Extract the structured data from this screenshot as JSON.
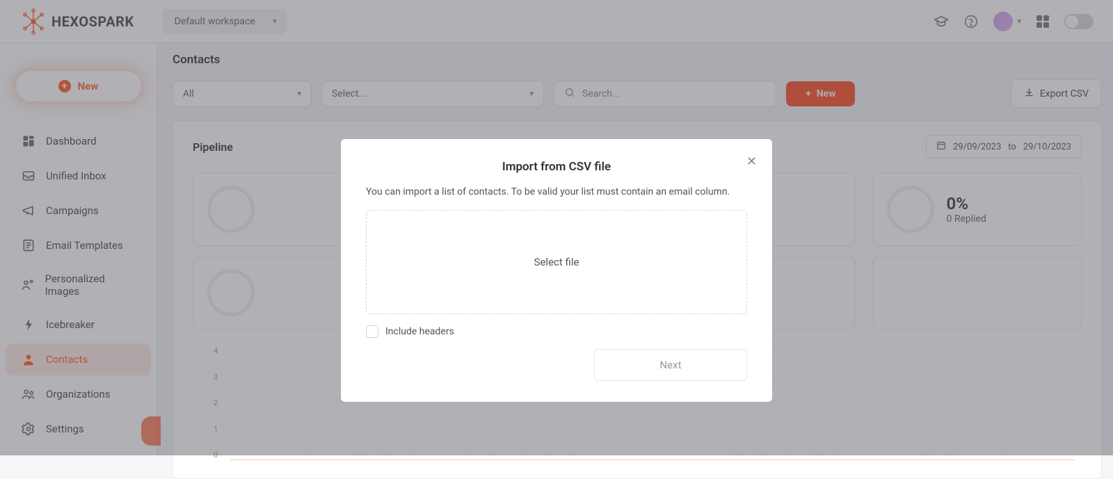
{
  "brand": "HEXOSPARK",
  "workspace": {
    "label": "Default workspace"
  },
  "sidebar": {
    "new_label": "New",
    "items": [
      {
        "label": "Dashboard",
        "icon": "dashboard-icon"
      },
      {
        "label": "Unified Inbox",
        "icon": "inbox-icon"
      },
      {
        "label": "Campaigns",
        "icon": "campaigns-icon"
      },
      {
        "label": "Email Templates",
        "icon": "templates-icon"
      },
      {
        "label": "Personalized Images",
        "icon": "images-icon"
      },
      {
        "label": "Icebreaker",
        "icon": "icebreaker-icon"
      },
      {
        "label": "Contacts",
        "icon": "contacts-icon"
      },
      {
        "label": "Organizations",
        "icon": "organizations-icon"
      },
      {
        "label": "Settings",
        "icon": "settings-icon"
      }
    ],
    "active_index": 6
  },
  "page": {
    "title": "Contacts"
  },
  "filters": {
    "all_label": "All",
    "select_placeholder": "Select...",
    "search_placeholder": "Search..."
  },
  "actions": {
    "new_label": "New",
    "export_label": "Export CSV"
  },
  "pipeline": {
    "title": "Pipeline",
    "date_from": "29/09/2023",
    "date_to_sep": "to",
    "date_to": "29/10/2023",
    "stats": [
      {
        "pct": "0%",
        "label": "0 Replied"
      }
    ],
    "chart_y_ticks": [
      "4",
      "3",
      "2",
      "1",
      "0"
    ]
  },
  "modal": {
    "title": "Import from CSV file",
    "description": "You can import a list of contacts. To be valid your list must contain an email column.",
    "select_file": "Select file",
    "include_headers": "Include headers",
    "next": "Next"
  }
}
